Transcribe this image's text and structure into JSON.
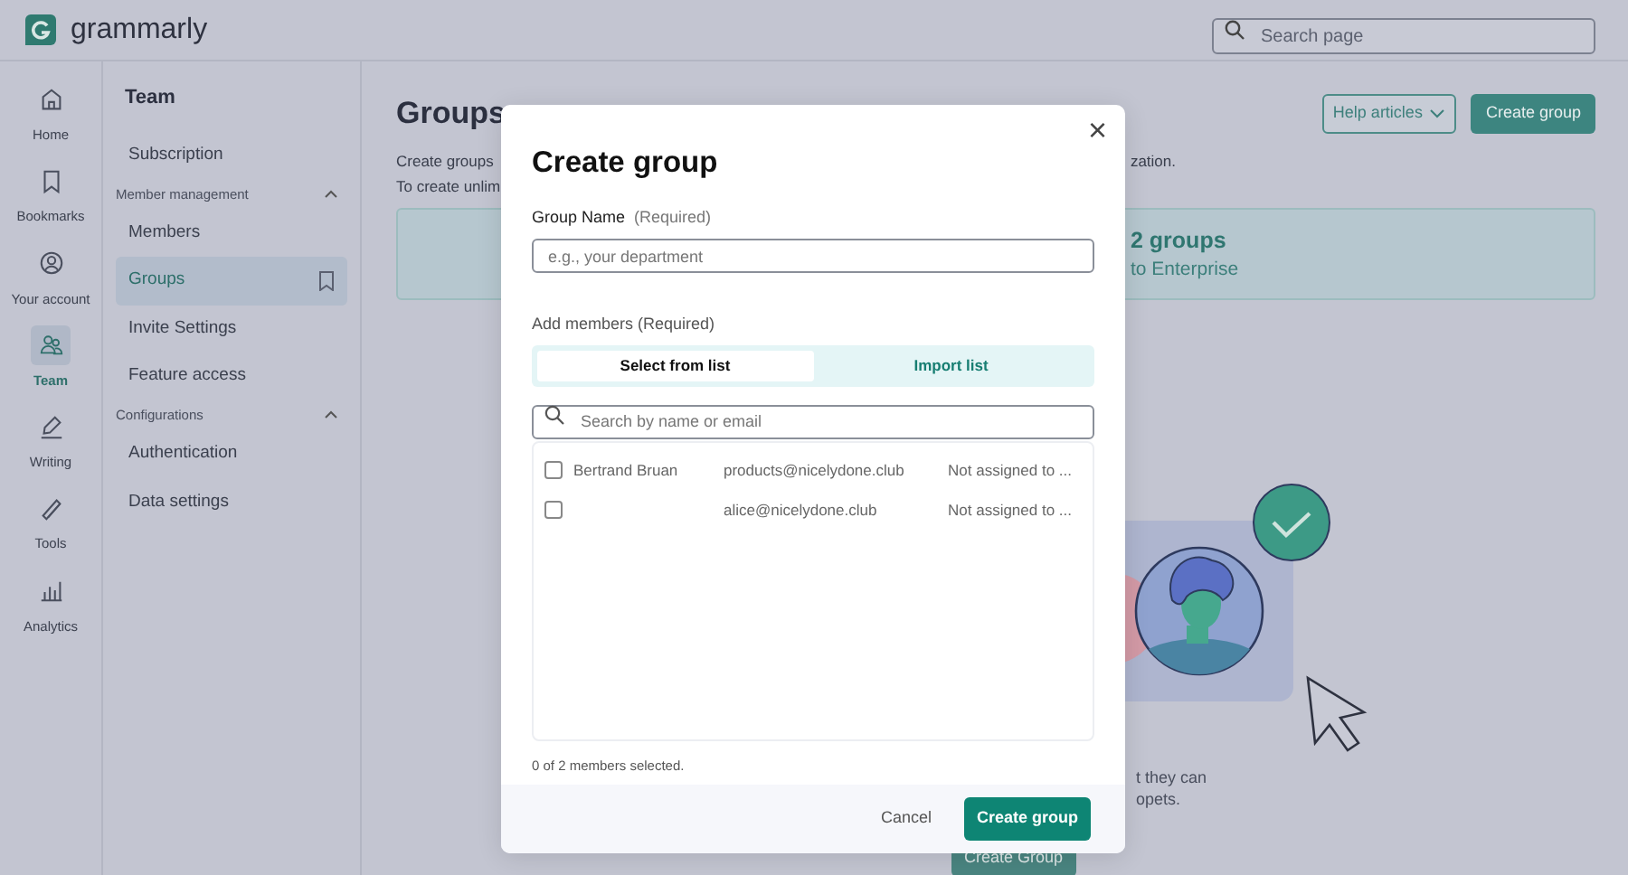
{
  "app": {
    "logo": "grammarly"
  },
  "search": {
    "placeholder": "Search page"
  },
  "nav_rail": [
    {
      "label": "Home",
      "selected": false
    },
    {
      "label": "Bookmarks",
      "selected": false
    },
    {
      "label": "Your account",
      "selected": false
    },
    {
      "label": "Team",
      "selected": true
    },
    {
      "label": "Writing",
      "selected": false
    },
    {
      "label": "Tools",
      "selected": false
    },
    {
      "label": "Analytics",
      "selected": false
    }
  ],
  "sidebar": {
    "title": "Team",
    "items": [
      {
        "kind": "link",
        "label": "Subscription",
        "selected": false
      },
      {
        "kind": "section",
        "label": "Member management",
        "expanded": true
      },
      {
        "kind": "link",
        "label": "Members",
        "selected": false
      },
      {
        "kind": "link",
        "label": "Groups",
        "selected": true
      },
      {
        "kind": "link",
        "label": "Invite Settings",
        "selected": false
      },
      {
        "kind": "link",
        "label": "Feature access",
        "selected": false
      },
      {
        "kind": "section",
        "label": "Configurations",
        "expanded": true
      },
      {
        "kind": "link",
        "label": "Authentication",
        "selected": false
      },
      {
        "kind": "link",
        "label": "Data settings",
        "selected": false
      }
    ]
  },
  "page": {
    "title": "Groups",
    "help_button": "Help articles",
    "create_button": "Create group",
    "intro": [
      "Create groups",
      "To create unlim"
    ],
    "intro_tail": "zation.",
    "banner": {
      "title": "2 groups",
      "subtitle": "to Enterprise"
    },
    "empty_text": [
      "t they can",
      "opets."
    ],
    "empty_button": "Create Group"
  },
  "dialog": {
    "title": "Create group",
    "close": "×",
    "name_label": "Group Name",
    "name_hint": "(Required)",
    "name_placeholder": "e.g., your department",
    "members_label": "Add members (Required)",
    "tabs": [
      {
        "label": "Select from list",
        "selected": true
      },
      {
        "label": "Import list",
        "selected": false
      }
    ],
    "search_placeholder": "Search by name or email",
    "members": [
      {
        "name": "Bertrand Bruan",
        "email": "products@nicelydone.club",
        "status": "Not assigned to ...",
        "checked": false
      },
      {
        "email": "alice@nicelydone.club",
        "status": "Not assigned to ...",
        "checked": false
      }
    ],
    "selection_count": "0 of 2 members selected.",
    "cancel": "Cancel",
    "submit": "Create group"
  }
}
